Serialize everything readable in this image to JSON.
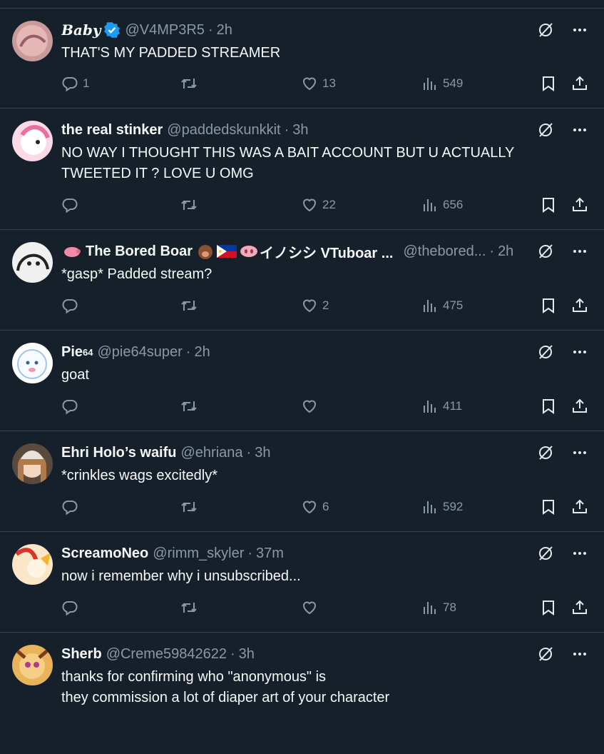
{
  "colors": {
    "background": "#15202b",
    "text": "#f7f9f9",
    "muted": "#8b98a5",
    "border": "#38444d",
    "verified": "#1d9bf0"
  },
  "tweets": [
    {
      "name": "Baby",
      "handle": "@V4MP3R5",
      "time": "2h",
      "text": "THAT'S MY PADDED STREAMER",
      "replies": "1",
      "retweets": "",
      "likes": "13",
      "views": "549"
    },
    {
      "name": "the real stinker",
      "handle": "@paddedskunkkit",
      "time": "3h",
      "text": "NO WAY I THOUGHT THIS WAS A BAIT ACCOUNT BUT U ACTUALLY TWEETED IT ?  LOVE U OMG",
      "replies": "",
      "retweets": "",
      "likes": "22",
      "views": "656"
    },
    {
      "name": "The Bored Boar",
      "name_suffix": "イノシシ VTuboar ...",
      "handle": "@thebored...",
      "time": "2h",
      "text": "*gasp* Padded stream?",
      "replies": "",
      "retweets": "",
      "likes": "2",
      "views": "475"
    },
    {
      "name": "Pie",
      "name_sup": "64",
      "handle": "@pie64super",
      "time": "2h",
      "text": "goat",
      "replies": "",
      "retweets": "",
      "likes": "",
      "views": "411"
    },
    {
      "name": "Ehri Holo’s waifu",
      "handle": "@ehriana",
      "time": "3h",
      "text": "*crinkles wags excitedly*",
      "replies": "",
      "retweets": "",
      "likes": "6",
      "views": "592"
    },
    {
      "name": "ScreamoNeo",
      "handle": "@rimm_skyler",
      "time": "37m",
      "text": "now i remember why i unsubscribed...",
      "replies": "",
      "retweets": "",
      "likes": "",
      "views": "78"
    },
    {
      "name": "Sherb",
      "handle": "@Creme59842622",
      "time": "3h",
      "text_line1": "thanks for confirming who \"anonymous\" is",
      "text_line2": "they commission a lot of diaper art of your character"
    }
  ],
  "icons": {
    "reply": "reply-icon",
    "retweet": "retweet-icon",
    "like": "like-icon",
    "views": "views-icon",
    "bookmark": "bookmark-icon",
    "share": "share-icon",
    "grok": "grok-icon",
    "more": "more-icon",
    "verified": "verified-badge-icon"
  }
}
